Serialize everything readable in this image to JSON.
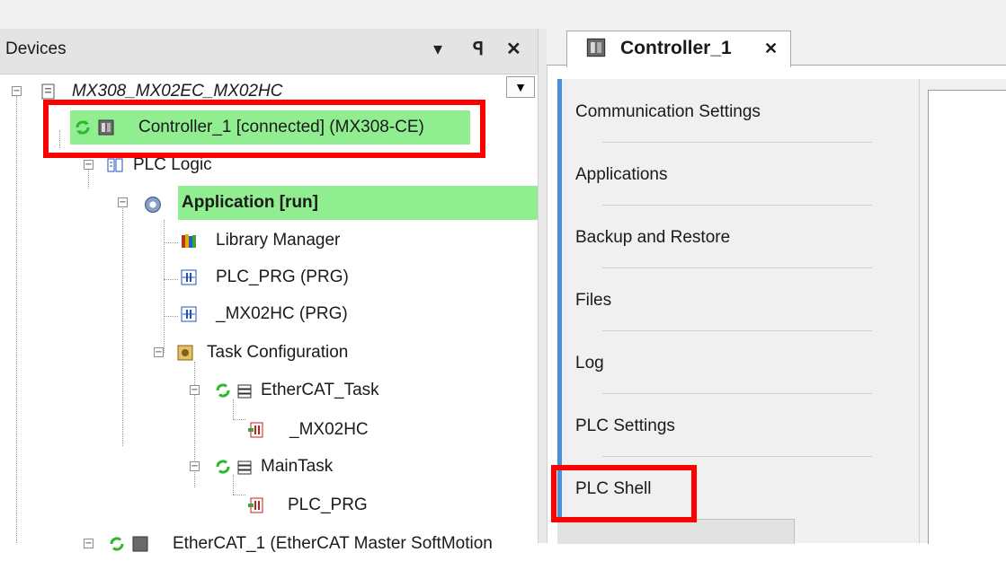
{
  "devices_panel": {
    "title": "Devices",
    "buttons": {
      "dropdown": "▾",
      "pin": "ꟼ",
      "close": "✕"
    },
    "tree": [
      {
        "label": "MX308_MX02EC_MX02HC",
        "icon": "project-icon",
        "italic": true
      },
      {
        "label": "Controller_1 [connected] (MX308-CE)",
        "icon": "controller-icon",
        "status": "connected"
      },
      {
        "label": "PLC Logic",
        "icon": "plc-logic-icon"
      },
      {
        "label": "Application [run]",
        "icon": "gear-icon",
        "bold": true
      },
      {
        "label": "Library Manager",
        "icon": "library-icon"
      },
      {
        "label": "PLC_PRG (PRG)",
        "icon": "program-icon"
      },
      {
        "label": "_MX02HC (PRG)",
        "icon": "program-icon"
      },
      {
        "label": "Task Configuration",
        "icon": "task-config-icon"
      },
      {
        "label": "EtherCAT_Task",
        "icon": "task-icon"
      },
      {
        "label": "_MX02HC",
        "icon": "task-call-icon"
      },
      {
        "label": "MainTask",
        "icon": "task-icon"
      },
      {
        "label": "PLC_PRG",
        "icon": "task-call-icon"
      },
      {
        "label": "EtherCAT_1 (EtherCAT Master SoftMotion",
        "icon": "ethercat-icon"
      }
    ]
  },
  "editor": {
    "tab": {
      "label": "Controller_1",
      "close": "✕"
    },
    "nav_items": [
      "Communication Settings",
      "Applications",
      "Backup and Restore",
      "Files",
      "Log",
      "PLC Settings",
      "PLC Shell"
    ]
  },
  "colors": {
    "highlight": "#90ee90",
    "annotation": "#ff0000",
    "nav_accent": "#4a90d9"
  }
}
